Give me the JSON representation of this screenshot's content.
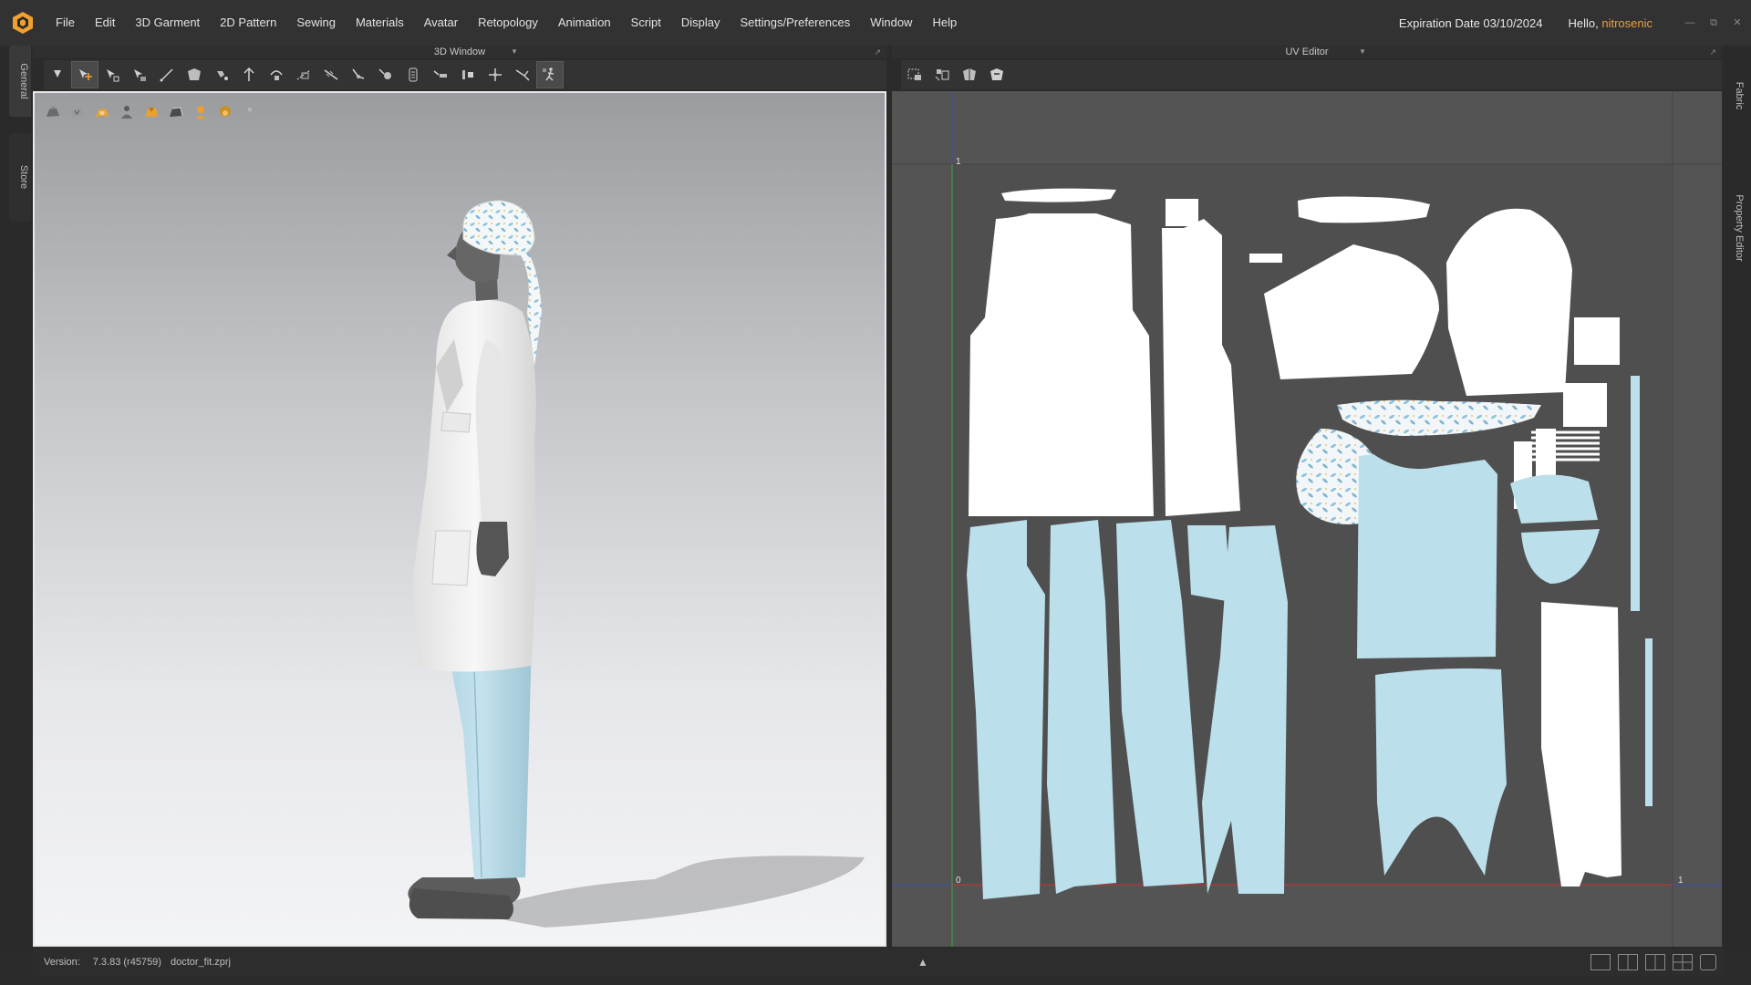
{
  "menubar": {
    "items": [
      "File",
      "Edit",
      "3D Garment",
      "2D Pattern",
      "Sewing",
      "Materials",
      "Avatar",
      "Retopology",
      "Animation",
      "Script",
      "Display",
      "Settings/Preferences",
      "Window",
      "Help"
    ],
    "expiration": "Expiration Date 03/10/2024",
    "hello_prefix": "Hello,",
    "username": "nitrosenic",
    "window_buttons": [
      "minimize-icon",
      "restore-icon",
      "close-icon"
    ]
  },
  "left_tabs": [
    "General",
    "Store"
  ],
  "right_tabs": [
    "Fabric",
    "Property Editor"
  ],
  "panel_3d": {
    "title": "3D Window"
  },
  "panel_uv": {
    "title": "UV Editor"
  },
  "toolbar_3d": {
    "icons": [
      "select-arrow-icon",
      "move-icon",
      "transform-icon",
      "select-mesh-icon",
      "edit-line-icon",
      "fold-icon",
      "pin-icon",
      "tack-icon",
      "attach-icon",
      "tape-icon",
      "measure-icon",
      "remove-icon",
      "sew-icon",
      "button-icon",
      "zipper-icon",
      "puckering-icon",
      "shirring-icon",
      "trim-icon",
      "avatar-pose-icon",
      "simulation-icon"
    ]
  },
  "toolbar_uv": {
    "icons": [
      "uv-select-icon",
      "uv-move-icon",
      "uv-pack-icon",
      "uv-transform-icon"
    ]
  },
  "viewport_icons": [
    "shading-icon",
    "texture-icon",
    "normal-icon",
    "avatar-display-icon",
    "garment-display-icon",
    "thickness-icon",
    "skin-icon",
    "hair-icon",
    "camera-icon"
  ],
  "uv_axis": {
    "top_left_tick": "1",
    "origin": "0",
    "right_tick": "1"
  },
  "status": {
    "label": "Version:",
    "version": "7.3.83 (r45759)",
    "file": "doctor_fit.zprj"
  },
  "colors": {
    "accent": "#e8a040",
    "coat_white": "#f2f2f2",
    "scrubs_blue": "#bcdfec",
    "uv_bg": "#545454",
    "x_axis": "#c03030",
    "y_axis": "#30a040"
  }
}
